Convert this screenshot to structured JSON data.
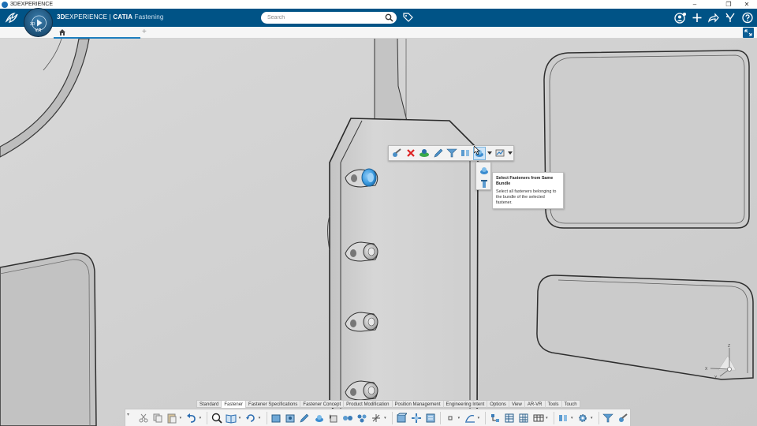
{
  "os": {
    "window_title": "3DEXPERIENCE",
    "controls": {
      "minimize": "–",
      "maximize": "❐",
      "close": "✕"
    }
  },
  "header": {
    "brand_bold": "3D",
    "brand_main": "EXPERIENCE",
    "brand_separator": " | ",
    "brand_app": "CATIA",
    "brand_app_thin": " Fastening",
    "compass_version": "V.R",
    "search_placeholder": "Search",
    "icons": [
      "ds-logo-icon",
      "search-icon",
      "tag-icon",
      "user-icon",
      "plus-icon",
      "share-icon",
      "tools-icon",
      "help-icon"
    ]
  },
  "tabs": {
    "home_icon": "home-icon",
    "add_label": "+"
  },
  "context_toolbar": {
    "buttons": [
      "fastener-edit-icon",
      "delete-icon",
      "fastener-green-icon",
      "pencil-icon",
      "fastener-filter-icon",
      "fastener-multi-icon",
      "select-bundle-icon",
      "analysis-icon"
    ]
  },
  "tooltip": {
    "title": "Select Fasteners from Same Bundle",
    "body": "Select all fasteners belonging to the bundle of the selected fastener."
  },
  "bottom_tabs": [
    {
      "label": "Standard",
      "active": false
    },
    {
      "label": "Fastener",
      "active": true
    },
    {
      "label": "Fastener Specifications",
      "active": false
    },
    {
      "label": "Fastener Concept",
      "active": false
    },
    {
      "label": "Product Modification",
      "active": false
    },
    {
      "label": "Position Management",
      "active": false
    },
    {
      "label": "Engineering Intent",
      "active": false
    },
    {
      "label": "Options",
      "active": false
    },
    {
      "label": "View",
      "active": false
    },
    {
      "label": "AR-VR",
      "active": false
    },
    {
      "label": "Tools",
      "active": false
    },
    {
      "label": "Touch",
      "active": false
    }
  ],
  "triad": {
    "x_label": "X",
    "y_label": "Y",
    "z_label": "Z"
  },
  "colors": {
    "header_bg": "#005386",
    "accent": "#1f7fbf",
    "selected_fastener": "#3b9be0",
    "viewport_bg": "#d1d1d1"
  }
}
